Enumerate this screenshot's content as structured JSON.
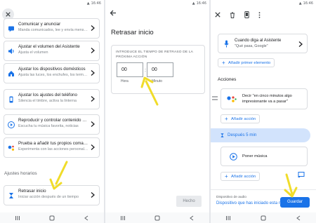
{
  "colors": {
    "accent": "#1a73e8",
    "arrow": "#f0dc2a",
    "highlight": "#d2e3fc"
  },
  "status": {
    "time": "16:46"
  },
  "panel1": {
    "cards": [
      {
        "title": "Comunicar y anunciar",
        "subtitle": "Manda comunicados, lee y envía mensajes",
        "icon": "chat-icon"
      },
      {
        "title": "Ajustar el volumen del Asistente",
        "subtitle": "Ajusta el volumen",
        "icon": "volume-icon"
      },
      {
        "title": "Ajustar los dispositivos domésticos",
        "subtitle": "Ajusta las luces, los enchufes, los termostatos",
        "icon": "home-icon"
      },
      {
        "title": "Ajustar los ajustes del teléfono",
        "subtitle": "Silencia el timbre, activa la linterna",
        "icon": "phone-icon"
      },
      {
        "title": "Reproducir y controlar contenido multimedia",
        "subtitle": "Escucha tu música favorita, noticias",
        "icon": "play-icon"
      },
      {
        "title": "Prueba a añadir tus propios comandos",
        "subtitle": "Experimenta con las acciones personalizadas",
        "icon": "assistant-icon"
      }
    ],
    "section_label": "Ajustes horarios",
    "timer_card": {
      "title": "Retrasar inicio",
      "subtitle": "Iniciar acción después de un tiempo",
      "icon": "hourglass-icon"
    }
  },
  "panel2": {
    "title": "Retrasar inicio",
    "caption": "INTRODUCE EL TIEMPO DE RETRASO DE LA PRÓXIMA ACCIÓN",
    "hours_value": "00",
    "minutes_value": "00",
    "hours_label": "Hora",
    "minutes_label": "Minuto",
    "done_label": "Hecho"
  },
  "panel3": {
    "starter": {
      "line1": "Cuando diga al Asistente",
      "line2": "\"Qué pasa, Google\""
    },
    "add_starter": "Añadir primer elemento",
    "actions_label": "Acciones",
    "action1": "Decir \"en cinco minutos algo impresionante va a pasar\"",
    "add_action1": "Añadir acción",
    "delay_label": "Después 5 min",
    "music_label": "Poner música",
    "add_action2": "Añadir acción",
    "device_label": "Dispositivo de audio",
    "device_value": "Dispositivo que has iniciado esta rutina",
    "save_label": "Guardar"
  }
}
